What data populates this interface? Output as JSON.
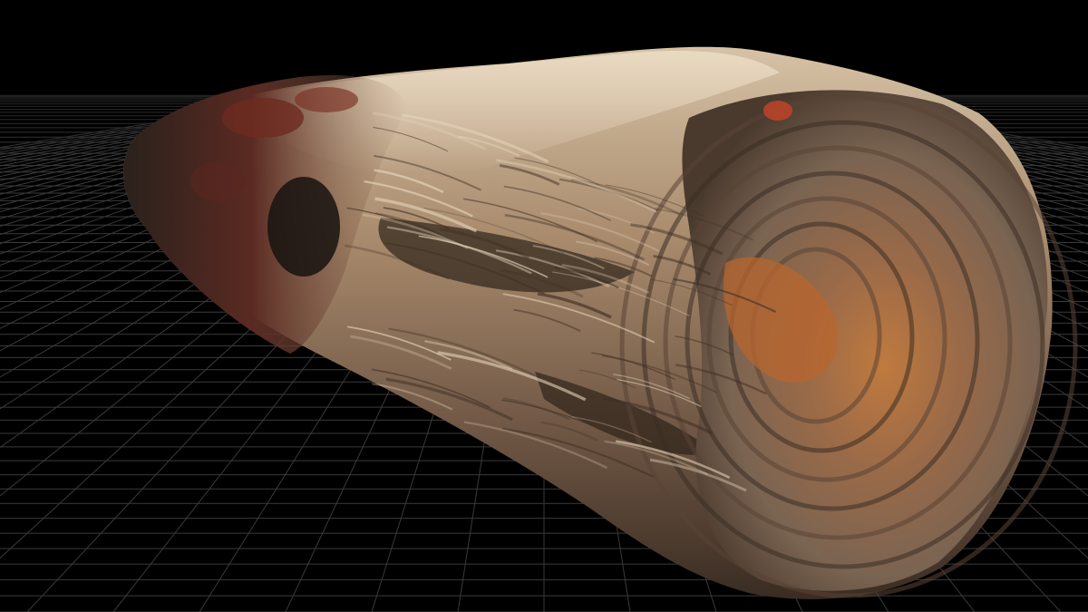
{
  "viewport": {
    "background_color": "#000000",
    "grid_color": "#3a3a3a",
    "horizon_color": "#141414",
    "grid_visible": true
  },
  "model": {
    "subject": "petrified-wood-log",
    "colors": {
      "bark_dark": "#1f1a16",
      "bark_red": "#6e2a20",
      "wood_light": "#c9b49a",
      "wood_mid": "#8a6e55",
      "wood_shadow": "#3a2c22",
      "core_orange": "#b8652e",
      "end_face": "#9a7a5e"
    }
  }
}
